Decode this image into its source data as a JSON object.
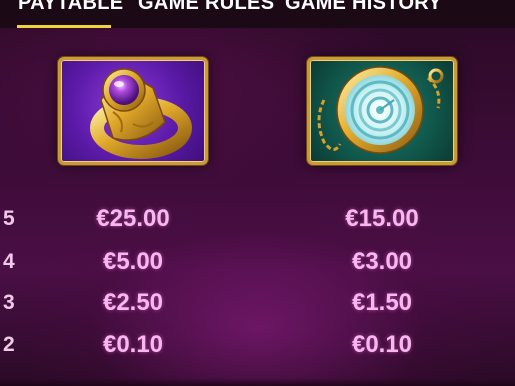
{
  "tabs": [
    {
      "label": "PAYTABLE",
      "active": true
    },
    {
      "label": "GAME RULES",
      "active": false
    },
    {
      "label": "GAME HISTORY",
      "active": false
    }
  ],
  "colors": {
    "active_underline": "#f0d43a",
    "payout_text": "#f7b8ef",
    "ring_card": "#5c1aa8",
    "watch_card": "#11574b",
    "card_border": "#c99a37"
  },
  "paytable": {
    "counts": [
      "5",
      "4",
      "3",
      "2"
    ],
    "symbols": [
      {
        "icon": "gold-ring-purple-gem-icon",
        "payouts": [
          "€25.00",
          "€5.00",
          "€2.50",
          "€0.10"
        ]
      },
      {
        "icon": "gold-pocket-watch-icon",
        "payouts": [
          "€15.00",
          "€3.00",
          "€1.50",
          "€0.10"
        ]
      }
    ]
  }
}
